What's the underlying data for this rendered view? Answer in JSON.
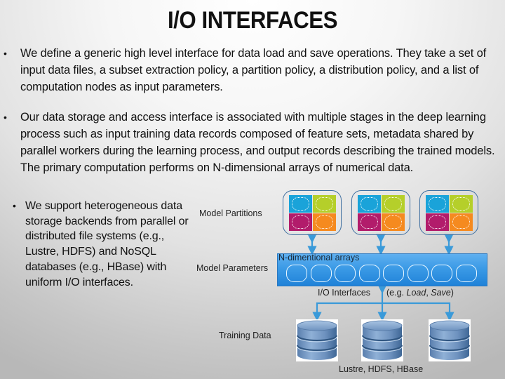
{
  "slide": {
    "title": "I/O INTERFACES"
  },
  "bullets": [
    {
      "marker": "•",
      "text": "We define a generic high level interface for data load and save operations. They take a set of input data files, a subset extraction policy, a partition policy, a distribution policy, and a list of computation nodes as input parameters."
    },
    {
      "marker": "•",
      "text": "Our data storage and access interface is associated with multiple stages in the deep learning process such as input training data records composed of feature sets, metadata shared by parallel workers during the learning process, and output records describing the trained models. The primary computation performs on N-dimensional arrays of numerical data."
    },
    {
      "marker": "•",
      "text": "We support heterogeneous data storage backends from parallel or distributed file systems (e.g., Lustre, HDFS) and NoSQL databases (e.g., HBase) with uniform I/O interfaces."
    }
  ],
  "diagram": {
    "labels": {
      "model_partitions": "Model Partitions",
      "model_parameters": "Model Parameters",
      "n_dim_arrays": "N-dimentional arrays",
      "io_interfaces": "I/O Interfaces",
      "eg_prefix": "(e.g. ",
      "eg_load": "Load",
      "eg_sep": ", ",
      "eg_save": "Save",
      "eg_suffix": ")",
      "training_data": "Training Data",
      "backends": "Lustre, HDFS, HBase"
    },
    "partition_colors": [
      "#1aa3d9",
      "#b5cf2a",
      "#b21c6b",
      "#f58a1f"
    ],
    "partition_count": 3,
    "array_cell_count": 8,
    "database_count": 3,
    "colors": {
      "bar_top": "#5fb0f0",
      "bar_bottom": "#1f82d8",
      "arrow": "#3a9ad9",
      "box_border": "#3f6fa0"
    },
    "icons": {
      "partition": "partition-grid-icon",
      "database": "database-cylinder-icon",
      "arrow": "bidirectional-arrow-icon"
    }
  }
}
